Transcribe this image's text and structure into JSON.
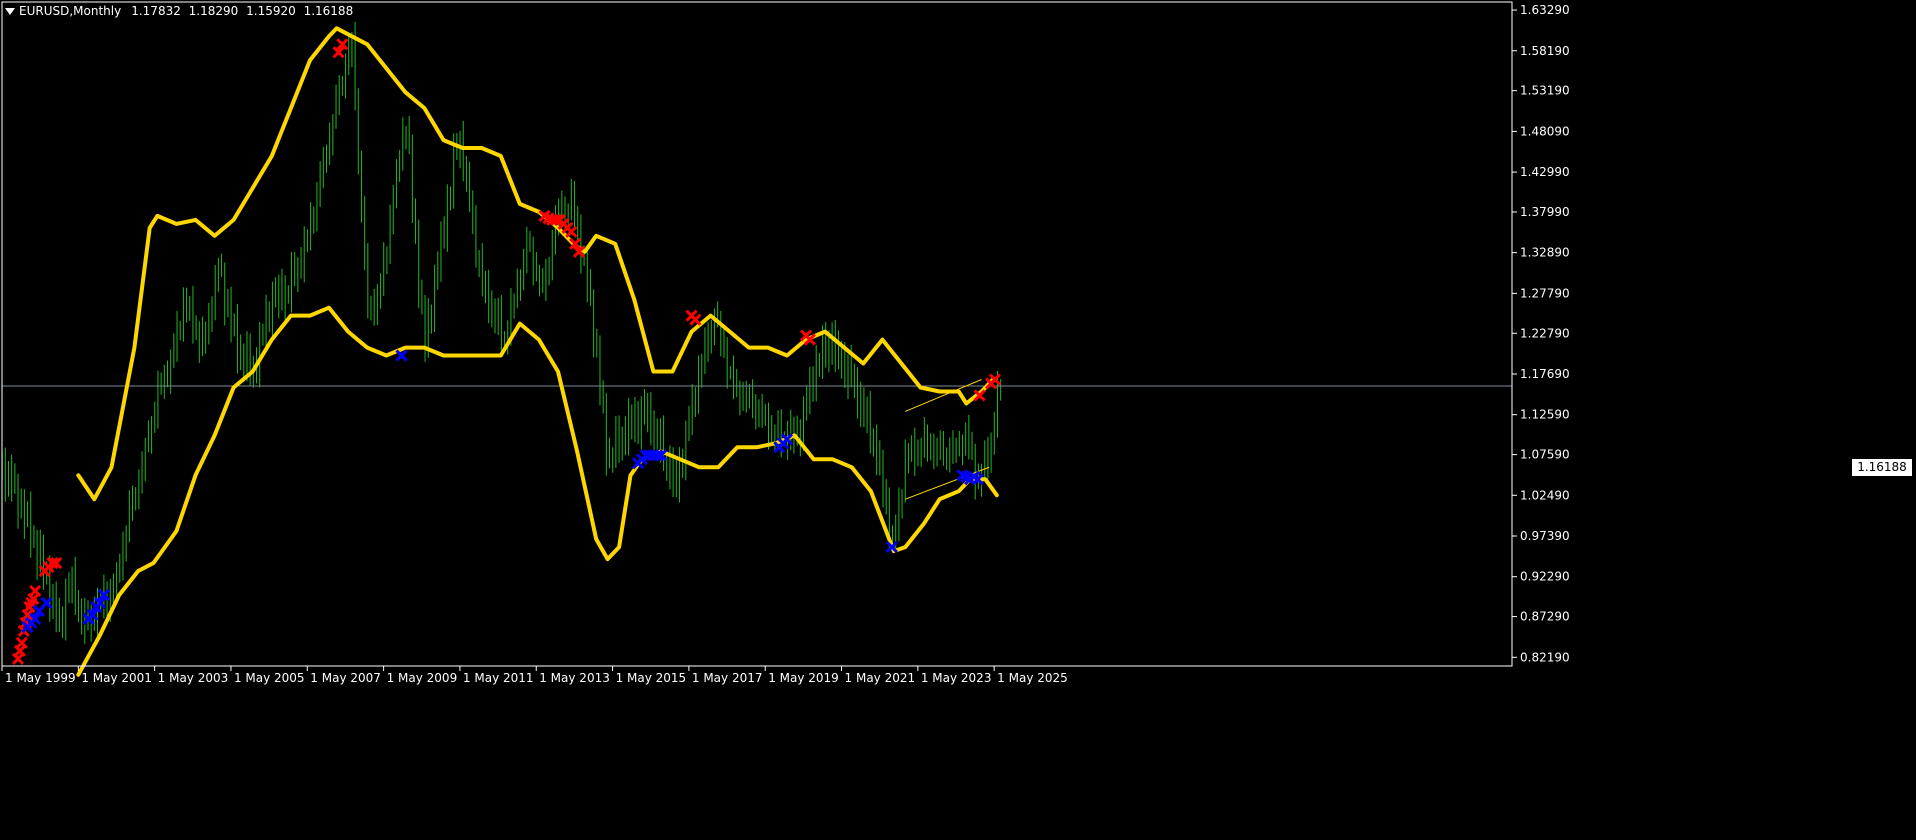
{
  "header": {
    "symbol": "EURUSD,Monthly",
    "open": "1.17832",
    "high": "1.18290",
    "low": "1.15920",
    "close": "1.16188"
  },
  "current_price_label": "1.16188",
  "colors": {
    "background": "#000000",
    "bars": "#22b822",
    "bands": "#ffd700",
    "sell_marks": "#ff0000",
    "buy_marks": "#0000ff",
    "grid_and_axes": "#ffffff",
    "price_line": "#7a8a9a",
    "channel": "#ffd700"
  },
  "chart_data": {
    "type": "line",
    "instrument": "EURUSD",
    "timeframe": "Monthly",
    "x_axis": {
      "tick_labels": [
        "1 May 1999",
        "1 May 2001",
        "1 May 2003",
        "1 May 2005",
        "1 May 2007",
        "1 May 2009",
        "1 May 2011",
        "1 May 2013",
        "1 May 2015",
        "1 May 2017",
        "1 May 2019",
        "1 May 2021",
        "1 May 2023",
        "1 May 2025"
      ],
      "tick_years": [
        1999.33,
        2001.33,
        2003.33,
        2005.33,
        2007.33,
        2009.33,
        2011.33,
        2013.33,
        2015.33,
        2017.33,
        2019.33,
        2021.33,
        2023.33,
        2025.33
      ],
      "range": [
        1999.33,
        2038.9
      ]
    },
    "y_axis": {
      "tick_labels": [
        "1.63290",
        "1.58190",
        "1.53190",
        "1.48090",
        "1.42990",
        "1.37990",
        "1.32890",
        "1.27790",
        "1.22790",
        "1.17690",
        "1.12590",
        "1.07590",
        "1.02490",
        "0.97390",
        "0.92290",
        "0.87290",
        "0.82190"
      ],
      "range": [
        0.811,
        1.643
      ]
    },
    "current_price": 1.16188,
    "series": [
      {
        "kind": "price",
        "points": [
          [
            1999.0,
            1.07
          ],
          [
            1999.5,
            1.05
          ],
          [
            2000.0,
            0.99
          ],
          [
            2000.5,
            0.92
          ],
          [
            2000.83,
            0.86
          ],
          [
            2001.1,
            0.92
          ],
          [
            2001.5,
            0.86
          ],
          [
            2001.9,
            0.89
          ],
          [
            2002.3,
            0.91
          ],
          [
            2002.6,
            0.99
          ],
          [
            2003.0,
            1.06
          ],
          [
            2003.4,
            1.15
          ],
          [
            2003.8,
            1.2
          ],
          [
            2004.1,
            1.27
          ],
          [
            2004.6,
            1.21
          ],
          [
            2005.0,
            1.31
          ],
          [
            2005.5,
            1.21
          ],
          [
            2005.9,
            1.18
          ],
          [
            2006.4,
            1.27
          ],
          [
            2006.8,
            1.28
          ],
          [
            2007.3,
            1.34
          ],
          [
            2007.8,
            1.45
          ],
          [
            2008.3,
            1.56
          ],
          [
            2008.5,
            1.59
          ],
          [
            2008.9,
            1.26
          ],
          [
            2009.2,
            1.27
          ],
          [
            2009.9,
            1.5
          ],
          [
            2010.4,
            1.21
          ],
          [
            2010.9,
            1.36
          ],
          [
            2011.3,
            1.48
          ],
          [
            2011.9,
            1.29
          ],
          [
            2012.5,
            1.22
          ],
          [
            2013.1,
            1.34
          ],
          [
            2013.5,
            1.28
          ],
          [
            2013.9,
            1.38
          ],
          [
            2014.3,
            1.39
          ],
          [
            2014.8,
            1.25
          ],
          [
            2015.2,
            1.07
          ],
          [
            2015.7,
            1.11
          ],
          [
            2016.2,
            1.13
          ],
          [
            2016.8,
            1.06
          ],
          [
            2017.0,
            1.04
          ],
          [
            2017.6,
            1.18
          ],
          [
            2018.0,
            1.25
          ],
          [
            2018.5,
            1.16
          ],
          [
            2019.0,
            1.14
          ],
          [
            2019.6,
            1.1
          ],
          [
            2020.2,
            1.1
          ],
          [
            2020.6,
            1.18
          ],
          [
            2021.0,
            1.22
          ],
          [
            2021.6,
            1.17
          ],
          [
            2022.2,
            1.09
          ],
          [
            2022.7,
            0.96
          ],
          [
            2023.0,
            1.07
          ],
          [
            2023.5,
            1.09
          ],
          [
            2023.9,
            1.08
          ],
          [
            2024.3,
            1.08
          ],
          [
            2024.6,
            1.1
          ],
          [
            2024.9,
            1.04
          ],
          [
            2025.2,
            1.08
          ],
          [
            2025.5,
            1.17
          ]
        ]
      },
      {
        "kind": "upper_band",
        "points": [
          [
            2001.33,
            1.05
          ],
          [
            2001.75,
            1.02
          ],
          [
            2002.2,
            1.06
          ],
          [
            2002.8,
            1.21
          ],
          [
            2003.2,
            1.36
          ],
          [
            2003.4,
            1.375
          ],
          [
            2003.9,
            1.365
          ],
          [
            2004.4,
            1.37
          ],
          [
            2004.9,
            1.35
          ],
          [
            2005.4,
            1.37
          ],
          [
            2005.9,
            1.41
          ],
          [
            2006.4,
            1.45
          ],
          [
            2006.9,
            1.51
          ],
          [
            2007.4,
            1.57
          ],
          [
            2007.9,
            1.6
          ],
          [
            2008.1,
            1.61
          ],
          [
            2008.5,
            1.6
          ],
          [
            2008.9,
            1.59
          ],
          [
            2009.4,
            1.56
          ],
          [
            2009.9,
            1.53
          ],
          [
            2010.4,
            1.51
          ],
          [
            2010.9,
            1.47
          ],
          [
            2011.4,
            1.46
          ],
          [
            2011.9,
            1.46
          ],
          [
            2012.4,
            1.45
          ],
          [
            2012.9,
            1.39
          ],
          [
            2013.4,
            1.38
          ],
          [
            2013.9,
            1.36
          ],
          [
            2014.3,
            1.34
          ],
          [
            2014.6,
            1.33
          ],
          [
            2014.9,
            1.35
          ],
          [
            2015.4,
            1.34
          ],
          [
            2015.9,
            1.27
          ],
          [
            2016.4,
            1.18
          ],
          [
            2016.9,
            1.18
          ],
          [
            2017.4,
            1.23
          ],
          [
            2017.9,
            1.25
          ],
          [
            2018.4,
            1.23
          ],
          [
            2018.9,
            1.21
          ],
          [
            2019.4,
            1.21
          ],
          [
            2019.9,
            1.2
          ],
          [
            2020.4,
            1.22
          ],
          [
            2020.9,
            1.23
          ],
          [
            2021.4,
            1.21
          ],
          [
            2021.9,
            1.19
          ],
          [
            2022.4,
            1.22
          ],
          [
            2022.9,
            1.19
          ],
          [
            2023.4,
            1.16
          ],
          [
            2023.9,
            1.155
          ],
          [
            2024.4,
            1.155
          ],
          [
            2024.6,
            1.14
          ],
          [
            2025.0,
            1.155
          ],
          [
            2025.3,
            1.17
          ]
        ]
      },
      {
        "kind": "lower_band",
        "points": [
          [
            2001.33,
            0.8
          ],
          [
            2001.9,
            0.85
          ],
          [
            2002.4,
            0.9
          ],
          [
            2002.9,
            0.93
          ],
          [
            2003.3,
            0.94
          ],
          [
            2003.9,
            0.98
          ],
          [
            2004.4,
            1.05
          ],
          [
            2004.9,
            1.1
          ],
          [
            2005.4,
            1.16
          ],
          [
            2005.9,
            1.18
          ],
          [
            2006.4,
            1.22
          ],
          [
            2006.9,
            1.25
          ],
          [
            2007.4,
            1.25
          ],
          [
            2007.9,
            1.26
          ],
          [
            2008.4,
            1.23
          ],
          [
            2008.9,
            1.21
          ],
          [
            2009.4,
            1.2
          ],
          [
            2009.9,
            1.21
          ],
          [
            2010.4,
            1.21
          ],
          [
            2010.9,
            1.2
          ],
          [
            2011.4,
            1.2
          ],
          [
            2011.9,
            1.2
          ],
          [
            2012.4,
            1.2
          ],
          [
            2012.9,
            1.24
          ],
          [
            2013.4,
            1.22
          ],
          [
            2013.9,
            1.18
          ],
          [
            2014.4,
            1.08
          ],
          [
            2014.9,
            0.97
          ],
          [
            2015.2,
            0.945
          ],
          [
            2015.5,
            0.96
          ],
          [
            2015.8,
            1.05
          ],
          [
            2016.1,
            1.07
          ],
          [
            2016.6,
            1.08
          ],
          [
            2017.1,
            1.07
          ],
          [
            2017.6,
            1.06
          ],
          [
            2018.1,
            1.06
          ],
          [
            2018.6,
            1.085
          ],
          [
            2019.1,
            1.085
          ],
          [
            2019.6,
            1.09
          ],
          [
            2020.1,
            1.1
          ],
          [
            2020.6,
            1.07
          ],
          [
            2021.1,
            1.07
          ],
          [
            2021.6,
            1.06
          ],
          [
            2022.1,
            1.03
          ],
          [
            2022.7,
            0.955
          ],
          [
            2023.0,
            0.96
          ],
          [
            2023.5,
            0.99
          ],
          [
            2023.9,
            1.02
          ],
          [
            2024.4,
            1.03
          ],
          [
            2024.7,
            1.045
          ],
          [
            2025.1,
            1.045
          ],
          [
            2025.4,
            1.025
          ]
        ]
      },
      {
        "kind": "channel",
        "lines": [
          [
            [
              2023.0,
              1.13
            ],
            [
              2025.0,
              1.17
            ]
          ],
          [
            [
              2023.0,
              1.02
            ],
            [
              2025.2,
              1.06
            ]
          ]
        ]
      }
    ],
    "sell_marks": [
      [
        1999.75,
        0.82
      ],
      [
        1999.8,
        0.83
      ],
      [
        1999.85,
        0.84
      ],
      [
        1999.9,
        0.855
      ],
      [
        1999.95,
        0.865
      ],
      [
        2000.0,
        0.875
      ],
      [
        2000.05,
        0.885
      ],
      [
        2000.1,
        0.89
      ],
      [
        2000.15,
        0.895
      ],
      [
        2000.2,
        0.905
      ],
      [
        2000.45,
        0.93
      ],
      [
        2000.55,
        0.935
      ],
      [
        2000.65,
        0.94
      ],
      [
        2000.75,
        0.94
      ],
      [
        2008.15,
        1.58
      ],
      [
        2008.25,
        1.59
      ],
      [
        2013.55,
        1.375
      ],
      [
        2013.65,
        1.372
      ],
      [
        2013.75,
        1.37
      ],
      [
        2013.85,
        1.37
      ],
      [
        2013.95,
        1.37
      ],
      [
        2014.05,
        1.365
      ],
      [
        2014.15,
        1.36
      ],
      [
        2014.25,
        1.355
      ],
      [
        2014.35,
        1.34
      ],
      [
        2014.45,
        1.33
      ],
      [
        2017.4,
        1.25
      ],
      [
        2017.5,
        1.245
      ],
      [
        2020.4,
        1.225
      ],
      [
        2020.5,
        1.22
      ],
      [
        2024.95,
        1.15
      ],
      [
        2025.25,
        1.165
      ],
      [
        2025.35,
        1.17
      ]
    ],
    "buy_marks": [
      [
        2000.0,
        0.86
      ],
      [
        2000.1,
        0.865
      ],
      [
        2000.2,
        0.87
      ],
      [
        2000.3,
        0.88
      ],
      [
        2000.5,
        0.89
      ],
      [
        2001.6,
        0.87
      ],
      [
        2001.7,
        0.875
      ],
      [
        2001.8,
        0.885
      ],
      [
        2001.9,
        0.89
      ],
      [
        2002.0,
        0.9
      ],
      [
        2009.8,
        1.2
      ],
      [
        2016.0,
        1.065
      ],
      [
        2016.1,
        1.07
      ],
      [
        2016.2,
        1.075
      ],
      [
        2016.3,
        1.075
      ],
      [
        2016.4,
        1.075
      ],
      [
        2016.5,
        1.075
      ],
      [
        2016.6,
        1.075
      ],
      [
        2019.7,
        1.085
      ],
      [
        2019.8,
        1.09
      ],
      [
        2019.9,
        1.095
      ],
      [
        2022.65,
        0.96
      ],
      [
        2024.5,
        1.05
      ],
      [
        2024.6,
        1.048
      ],
      [
        2024.7,
        1.045
      ],
      [
        2024.8,
        1.048
      ],
      [
        2024.9,
        1.045
      ]
    ]
  }
}
